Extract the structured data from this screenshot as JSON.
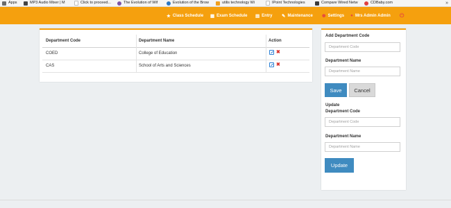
{
  "bookmarks": {
    "items": [
      {
        "label": "Apps",
        "icon": "apps-grid-icon",
        "color": "#6b6b6b"
      },
      {
        "label": "MP3 Audio Mixer | M",
        "icon": "mixer-icon",
        "color": "#444444"
      },
      {
        "label": "Click to proceed...",
        "icon": "page-icon",
        "color": "#bdbdbd"
      },
      {
        "label": "The Evolution of Wif",
        "icon": "evolution-icon",
        "color": "#7b55a8"
      },
      {
        "label": "Evolution of the Brow",
        "icon": "globe-icon",
        "color": "#2b78c5"
      },
      {
        "label": "utilis technology Wi",
        "icon": "utilis-icon",
        "color": "#f0a020"
      },
      {
        "label": "IPoint Technologies",
        "icon": "page-icon",
        "color": "#bdbdbd"
      },
      {
        "label": "Compare Wired Netw",
        "icon": "compare-icon",
        "color": "#3a3a3a"
      },
      {
        "label": "CDBaby.com",
        "icon": "cdbaby-icon",
        "color": "#e04040"
      }
    ],
    "more": "»"
  },
  "navbar": {
    "color": "#f5a00e",
    "items": [
      {
        "label": "Class Schedule",
        "icon": "star-icon",
        "glyph": "★"
      },
      {
        "label": "Exam Schedule",
        "icon": "calendar-icon",
        "glyph": "▦"
      },
      {
        "label": "Entry",
        "icon": "file-icon",
        "glyph": "▤"
      },
      {
        "label": "Maintenance",
        "icon": "wrench-icon",
        "glyph": "✎"
      },
      {
        "label": "Settings",
        "icon": "gear-icon",
        "glyph": "✺"
      },
      {
        "label": "Mrs Admin Admin",
        "icon": "user-icon",
        "glyph": "●"
      }
    ],
    "power_icon": "power-icon",
    "power_glyph": "⏻"
  },
  "table": {
    "headers": {
      "code": "Department Code",
      "name": "Department Name",
      "action": "Action"
    },
    "rows": [
      {
        "code": "COED",
        "name": "College of Education"
      },
      {
        "code": "CAS",
        "name": "School of Arts and Sciences"
      }
    ],
    "edit_icon": "edit-icon",
    "delete_icon": "delete-icon",
    "delete_glyph": "✖"
  },
  "add_form": {
    "title": "Add Department Code",
    "code_placeholder": "Department Code",
    "name_label": "Department Name",
    "name_placeholder": "Department Name",
    "save_label": "Save",
    "cancel_label": "Cancel"
  },
  "update_form": {
    "title": "Update",
    "code_label": "Department Code",
    "code_placeholder": "Department Code",
    "name_label": "Department Name",
    "name_placeholder": "Department Name",
    "update_label": "Update"
  }
}
